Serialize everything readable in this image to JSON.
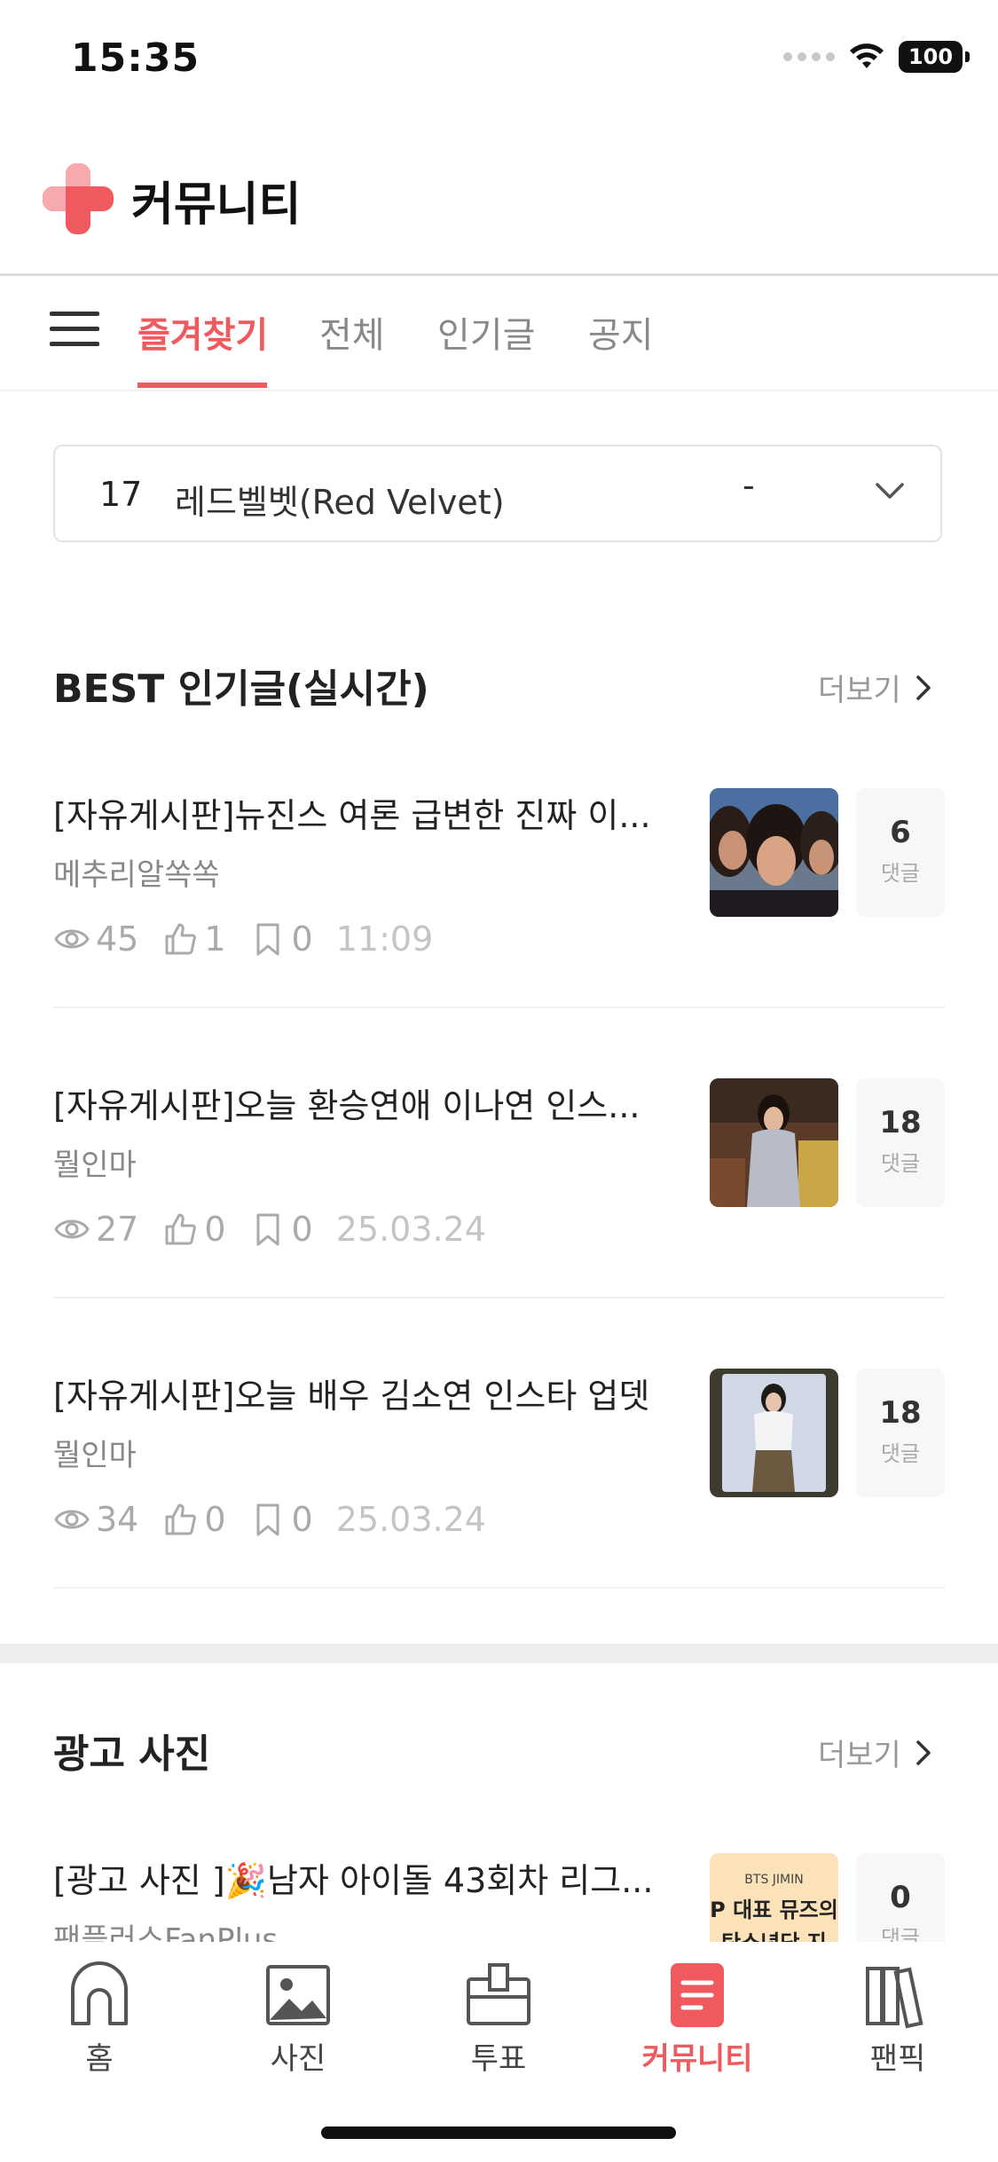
{
  "status_bar": {
    "time": "15:35",
    "battery": "100"
  },
  "header": {
    "title": "커뮤니티"
  },
  "tabs": [
    {
      "label": "즐겨찾기",
      "active": true
    },
    {
      "label": "전체",
      "active": false
    },
    {
      "label": "인기글",
      "active": false
    },
    {
      "label": "공지",
      "active": false
    }
  ],
  "selector": {
    "rank": "17",
    "name": "레드벨벳(Red Velvet)",
    "extra": "-"
  },
  "best_section": {
    "title": "BEST 인기글(실시간)",
    "more": "더보기",
    "posts": [
      {
        "title": "[자유게시판]뉴진스 여론 급변한 진짜 이...",
        "author": "메추리알쏙쏙",
        "views": "45",
        "likes": "1",
        "bookmarks": "0",
        "time": "11:09",
        "comments": "6",
        "comments_label": "댓글"
      },
      {
        "title": "[자유게시판]오늘 환승연애 이나연 인스...",
        "author": "뭘인마",
        "views": "27",
        "likes": "0",
        "bookmarks": "0",
        "time": "25.03.24",
        "comments": "18",
        "comments_label": "댓글"
      },
      {
        "title": "[자유게시판]오늘 배우 김소연 인스타 업뎃",
        "author": "뭘인마",
        "views": "34",
        "likes": "0",
        "bookmarks": "0",
        "time": "25.03.24",
        "comments": "18",
        "comments_label": "댓글"
      }
    ]
  },
  "ad_section": {
    "title": "광고 사진",
    "more": "더보기",
    "posts": [
      {
        "title": "[광고 사진 ]🎉남자 아이돌 43회차 리그...",
        "author": "팬플러스FanPlus",
        "comments": "0",
        "comments_label": "댓글",
        "thumb_text_1": "BTS JIMIN",
        "thumb_text_2": "P 대표 뮤즈의",
        "thumb_text_3": "탄소년단 지"
      }
    ]
  },
  "bottom_nav": [
    {
      "label": "홈",
      "icon": "home-icon"
    },
    {
      "label": "사진",
      "icon": "photo-icon"
    },
    {
      "label": "투표",
      "icon": "vote-icon"
    },
    {
      "label": "커뮤니티",
      "icon": "community-icon",
      "active": true
    },
    {
      "label": "팬픽",
      "icon": "fanfic-icon"
    }
  ],
  "colors": {
    "accent": "#f05a5e",
    "logo_light": "#f7a9ad"
  }
}
